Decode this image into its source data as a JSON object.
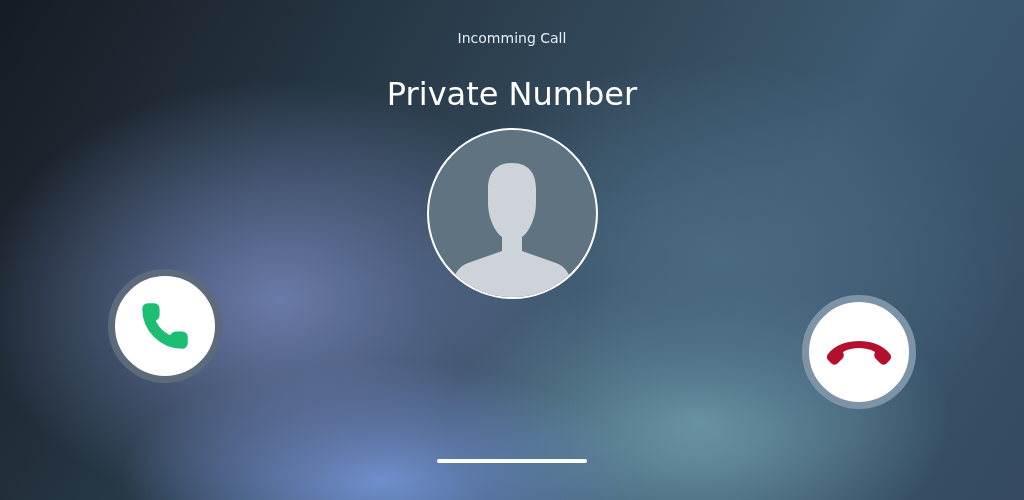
{
  "header": {
    "title": "Incomming Call"
  },
  "caller": {
    "name": "Private Number"
  },
  "actions": [
    {
      "kind": "accept"
    },
    {
      "kind": "decline"
    }
  ]
}
